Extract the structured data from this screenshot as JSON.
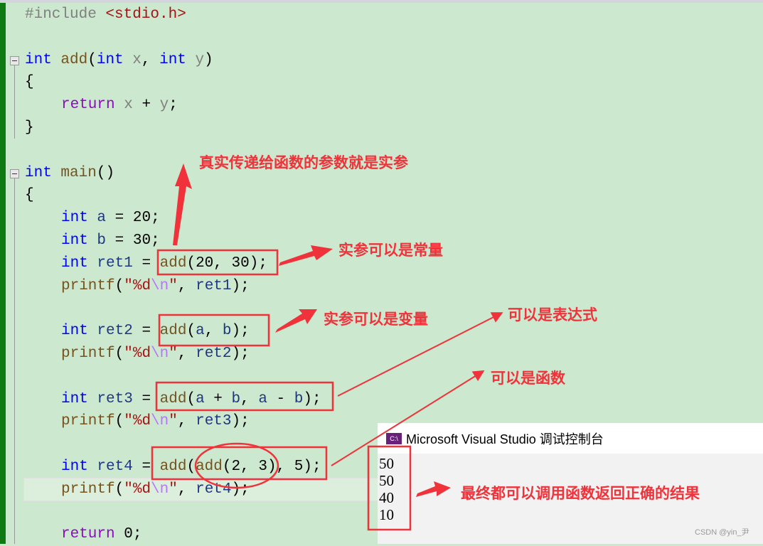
{
  "editor": {
    "lines": [
      {
        "indent": 0,
        "tokens": [
          [
            "#include ",
            "pp"
          ],
          [
            "<stdio.h>",
            "str"
          ]
        ]
      },
      {
        "indent": 0,
        "tokens": []
      },
      {
        "indent": 0,
        "fold": true,
        "tokens": [
          [
            "int",
            "kw"
          ],
          [
            " "
          ],
          [
            "add",
            "fn"
          ],
          [
            "("
          ],
          [
            "int",
            "kw"
          ],
          [
            " "
          ],
          [
            "x",
            "prm"
          ],
          [
            ", "
          ],
          [
            "int",
            "kw"
          ],
          [
            " "
          ],
          [
            "y",
            "prm"
          ],
          [
            ")"
          ]
        ]
      },
      {
        "indent": 0,
        "tokens": [
          [
            "{"
          ]
        ]
      },
      {
        "indent": 1,
        "tokens": [
          [
            "return",
            "ret"
          ],
          [
            " "
          ],
          [
            "x",
            "prm"
          ],
          [
            " + "
          ],
          [
            "y",
            "prm"
          ],
          [
            ";"
          ]
        ]
      },
      {
        "indent": 0,
        "tokens": [
          [
            "}"
          ]
        ]
      },
      {
        "indent": 0,
        "tokens": []
      },
      {
        "indent": 0,
        "fold": true,
        "tokens": [
          [
            "int",
            "kw"
          ],
          [
            " "
          ],
          [
            "main",
            "fn"
          ],
          [
            "()"
          ]
        ]
      },
      {
        "indent": 0,
        "tokens": [
          [
            "{"
          ]
        ]
      },
      {
        "indent": 1,
        "tokens": [
          [
            "int",
            "kw"
          ],
          [
            " "
          ],
          [
            "a",
            "var"
          ],
          [
            " = "
          ],
          [
            "20",
            "num"
          ],
          [
            ";"
          ]
        ]
      },
      {
        "indent": 1,
        "tokens": [
          [
            "int",
            "kw"
          ],
          [
            " "
          ],
          [
            "b",
            "var"
          ],
          [
            " = "
          ],
          [
            "30",
            "num"
          ],
          [
            ";"
          ]
        ]
      },
      {
        "indent": 1,
        "tokens": [
          [
            "int",
            "kw"
          ],
          [
            " "
          ],
          [
            "ret1",
            "var"
          ],
          [
            " = "
          ],
          [
            "add",
            "fn"
          ],
          [
            "("
          ],
          [
            "20",
            "num"
          ],
          [
            ", "
          ],
          [
            "30",
            "num"
          ],
          [
            ");"
          ]
        ]
      },
      {
        "indent": 1,
        "tokens": [
          [
            "printf",
            "fn"
          ],
          [
            "("
          ],
          [
            "\"%d",
            "str"
          ],
          [
            "\\n",
            "esc"
          ],
          [
            "\"",
            "str"
          ],
          [
            ", "
          ],
          [
            "ret1",
            "var"
          ],
          [
            ");"
          ]
        ]
      },
      {
        "indent": 0,
        "tokens": []
      },
      {
        "indent": 1,
        "tokens": [
          [
            "int",
            "kw"
          ],
          [
            " "
          ],
          [
            "ret2",
            "var"
          ],
          [
            " = "
          ],
          [
            "add",
            "fn"
          ],
          [
            "("
          ],
          [
            "a",
            "var"
          ],
          [
            ", "
          ],
          [
            "b",
            "var"
          ],
          [
            ");"
          ]
        ]
      },
      {
        "indent": 1,
        "tokens": [
          [
            "printf",
            "fn"
          ],
          [
            "("
          ],
          [
            "\"%d",
            "str"
          ],
          [
            "\\n",
            "esc"
          ],
          [
            "\"",
            "str"
          ],
          [
            ", "
          ],
          [
            "ret2",
            "var"
          ],
          [
            ");"
          ]
        ]
      },
      {
        "indent": 0,
        "tokens": []
      },
      {
        "indent": 1,
        "tokens": [
          [
            "int",
            "kw"
          ],
          [
            " "
          ],
          [
            "ret3",
            "var"
          ],
          [
            " = "
          ],
          [
            "add",
            "fn"
          ],
          [
            "("
          ],
          [
            "a",
            "var"
          ],
          [
            " + "
          ],
          [
            "b",
            "var"
          ],
          [
            ", "
          ],
          [
            "a",
            "var"
          ],
          [
            " - "
          ],
          [
            "b",
            "var"
          ],
          [
            ");"
          ]
        ]
      },
      {
        "indent": 1,
        "tokens": [
          [
            "printf",
            "fn"
          ],
          [
            "("
          ],
          [
            "\"%d",
            "str"
          ],
          [
            "\\n",
            "esc"
          ],
          [
            "\"",
            "str"
          ],
          [
            ", "
          ],
          [
            "ret3",
            "var"
          ],
          [
            ");"
          ]
        ]
      },
      {
        "indent": 0,
        "tokens": []
      },
      {
        "indent": 1,
        "tokens": [
          [
            "int",
            "kw"
          ],
          [
            " "
          ],
          [
            "ret4",
            "var"
          ],
          [
            " = "
          ],
          [
            "add",
            "fn"
          ],
          [
            "("
          ],
          [
            "add",
            "fn"
          ],
          [
            "("
          ],
          [
            "2",
            "num"
          ],
          [
            ", "
          ],
          [
            "3",
            "num"
          ],
          [
            "), "
          ],
          [
            "5",
            "num"
          ],
          [
            ");"
          ]
        ]
      },
      {
        "indent": 1,
        "tokens": [
          [
            "printf",
            "fn"
          ],
          [
            "("
          ],
          [
            "\"%d",
            "str"
          ],
          [
            "\\n",
            "esc"
          ],
          [
            "\"",
            "str"
          ],
          [
            ", "
          ],
          [
            "ret4",
            "var"
          ],
          [
            ");"
          ]
        ]
      },
      {
        "indent": 0,
        "tokens": []
      },
      {
        "indent": 1,
        "tokens": [
          [
            "return",
            "ret"
          ],
          [
            " "
          ],
          [
            "0",
            "num"
          ],
          [
            ";"
          ]
        ]
      }
    ]
  },
  "console": {
    "title": "Microsoft Visual Studio 调试控制台",
    "icon": "console-app-icon",
    "icon_text": "C:\\",
    "output": [
      "50",
      "50",
      "40",
      "10"
    ]
  },
  "annotations": {
    "actual_param": "真实传递给函数的参数就是实参",
    "constant": "实参可以是常量",
    "variable": "实参可以是变量",
    "expression": "可以是表达式",
    "function": "可以是函数",
    "result": "最终都可以调用函数返回正确的结果"
  },
  "watermark": "CSDN @yin_尹",
  "colors": {
    "annotation": "#f0323a",
    "editor_bg": "#cce8cf"
  }
}
